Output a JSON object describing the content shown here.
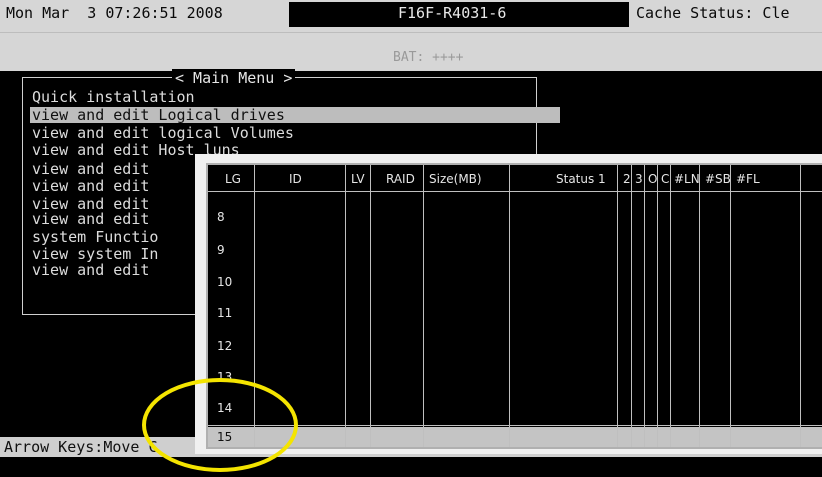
{
  "topbar": {
    "datetime": "Mon Mar  3 07:26:51 2008",
    "controller_name": "F16F-R4031-6",
    "cache_status": "Cache Status: Cle",
    "battery": "BAT: ++++"
  },
  "main_menu": {
    "title": "< Main Menu >",
    "items": [
      {
        "label": "Quick installation"
      },
      {
        "label": "view and edit Logical drives",
        "selected": true
      },
      {
        "label": "view and edit logical Volumes"
      },
      {
        "label": "view and edit Host luns"
      },
      {
        "label": "view and edit"
      },
      {
        "label": "view and edit"
      },
      {
        "label": "view and edit"
      },
      {
        "label": "view and edit"
      },
      {
        "label": "system Functio"
      },
      {
        "label": "view system In"
      },
      {
        "label": "view and edit"
      }
    ]
  },
  "status_line": "Arrow Keys:Move C",
  "logical_drives_table": {
    "columns": [
      "LG",
      "ID",
      "LV",
      "RAID",
      "Size(MB)",
      "Status 1",
      "2",
      "3",
      "O",
      "C",
      "#LN",
      "#SB",
      "#FL"
    ],
    "rows": [
      {
        "lg": "8"
      },
      {
        "lg": "9"
      },
      {
        "lg": "10"
      },
      {
        "lg": "11"
      },
      {
        "lg": "12"
      },
      {
        "lg": "13"
      },
      {
        "lg": "14"
      },
      {
        "lg": "15",
        "selected": true
      }
    ]
  },
  "colors": {
    "background": "#000000",
    "bar": "#d6d6d6",
    "highlight_ellipse": "#f4e400",
    "selection": "#bdbdbd"
  }
}
